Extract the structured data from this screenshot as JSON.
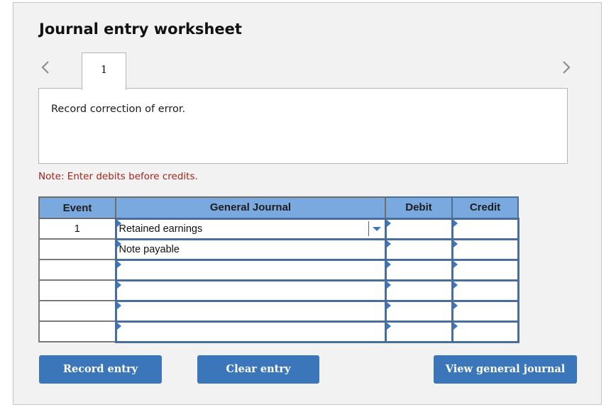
{
  "worksheet": {
    "title": "Journal entry worksheet",
    "nav": {
      "prev_icon": "chevron-left-icon",
      "next_icon": "chevron-right-icon"
    },
    "tabs": [
      {
        "label": "1",
        "active": true
      }
    ],
    "prompt": "Record correction of error.",
    "note": "Note: Enter debits before credits."
  },
  "journal": {
    "headers": {
      "event": "Event",
      "account": "General Journal",
      "debit": "Debit",
      "credit": "Credit"
    },
    "rows": [
      {
        "event": "1",
        "account": "Retained earnings",
        "debit": "",
        "credit": "",
        "has_dropdown": true
      },
      {
        "event": "",
        "account": "Note payable",
        "debit": "",
        "credit": ""
      },
      {
        "event": "",
        "account": "",
        "debit": "",
        "credit": ""
      },
      {
        "event": "",
        "account": "",
        "debit": "",
        "credit": ""
      },
      {
        "event": "",
        "account": "",
        "debit": "",
        "credit": ""
      },
      {
        "event": "",
        "account": "",
        "debit": "",
        "credit": ""
      }
    ]
  },
  "buttons": {
    "record": "Record entry",
    "clear": "Clear entry",
    "view": "View general journal"
  },
  "colors": {
    "header_bg": "#7aa9e0",
    "button_bg": "#3a76b9",
    "note_text": "#a3241c",
    "input_border": "#4a6e9b"
  }
}
